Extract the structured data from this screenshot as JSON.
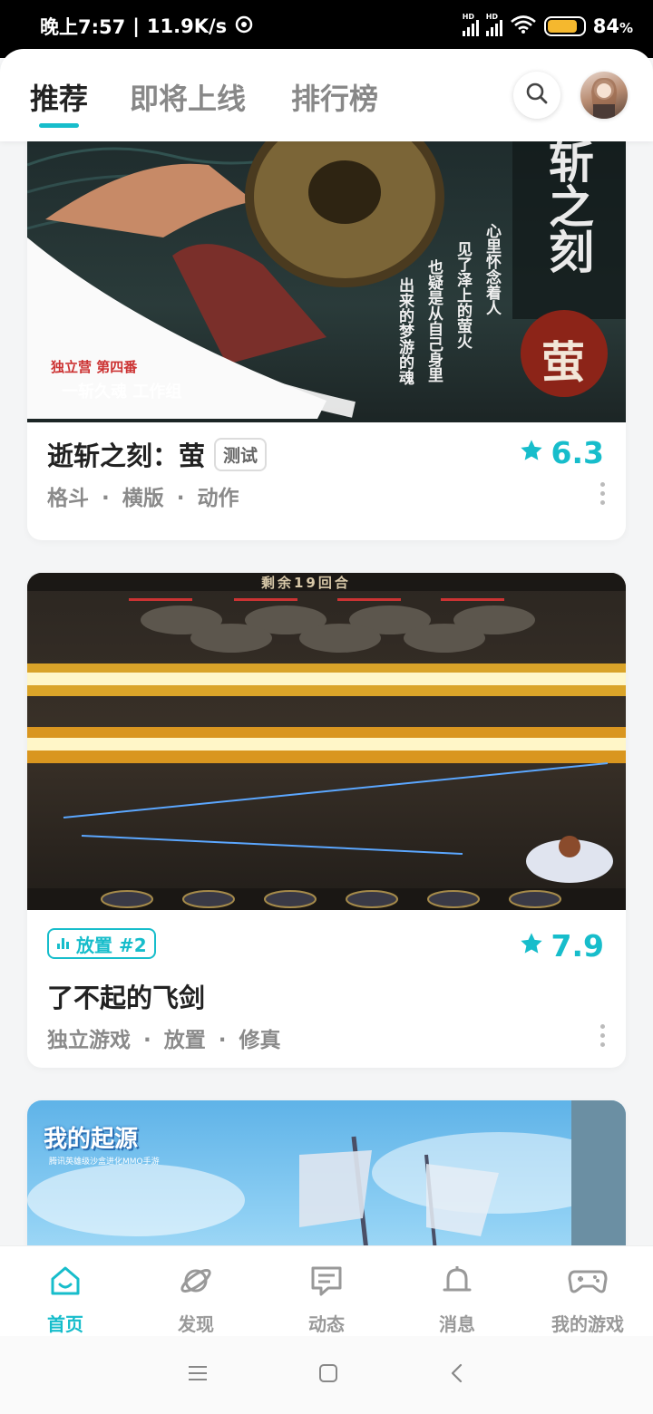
{
  "status_bar": {
    "time": "晚上7:57",
    "net_speed": "11.9K/s",
    "battery": "84",
    "battery_unit": "%",
    "battery_level": 0.84
  },
  "header": {
    "tabs": [
      {
        "label": "推荐",
        "active": true
      },
      {
        "label": "即将上线",
        "active": false
      },
      {
        "label": "排行榜",
        "active": false
      }
    ],
    "search_icon": "search-icon",
    "avatar_icon": "avatar"
  },
  "colors": {
    "accent": "#17bdcb",
    "battery": "#f5b82e",
    "text_primary": "#222222",
    "text_secondary": "#8a8a8a"
  },
  "feed": {
    "cards": [
      {
        "title": "逝斩之刻：萤",
        "badge": "测试",
        "rating": "6.3",
        "tags": [
          "格斗",
          "横版",
          "动作"
        ],
        "tag_separator": "·",
        "image_text": {
          "title_glyphs": "斩之刻",
          "seal_glyph": "萤",
          "poem_lines": [
            "心里怀念着人",
            "见了泽上的萤火",
            "也疑是从自己身里",
            "出来的梦游的魂"
          ],
          "studio_line1": "独立营 第四番",
          "studio_line2": "一斩久魂 工作组"
        }
      },
      {
        "title": "了不起的飞剑",
        "rank_badge": "放置 #2",
        "rating": "7.9",
        "tags": [
          "独立游戏",
          "放置",
          "修真"
        ],
        "tag_separator": "·",
        "image_text": {
          "round_banner": "剩余19回合"
        }
      },
      {
        "image_text": {
          "logo": "我的起源",
          "logo_sub": "腾讯英雄级沙盒进化MMO手游"
        }
      }
    ]
  },
  "bottom_nav": [
    {
      "label": "首页",
      "icon": "home-icon",
      "active": true
    },
    {
      "label": "发现",
      "icon": "discover-planet-icon",
      "active": false
    },
    {
      "label": "动态",
      "icon": "chat-bubble-icon",
      "active": false
    },
    {
      "label": "消息",
      "icon": "bell-icon",
      "active": false
    },
    {
      "label": "我的游戏",
      "icon": "gamepad-icon",
      "active": false
    }
  ],
  "system_nav": [
    "menu-icon",
    "home-square-icon",
    "back-icon"
  ]
}
